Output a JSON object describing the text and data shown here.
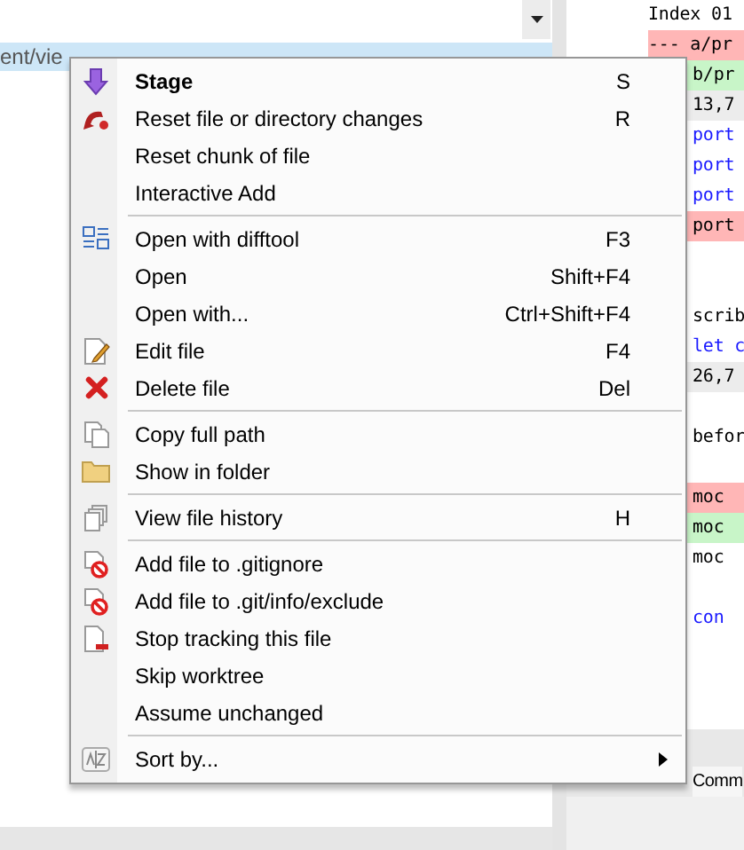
{
  "file_list": {
    "selected_row": {
      "text": "ent/vie",
      "selected": true
    }
  },
  "context_menu": {
    "sections": [
      [
        {
          "label": "Stage",
          "shortcut": "S",
          "default": true,
          "submenu": false
        },
        {
          "label": "Reset file or directory changes",
          "shortcut": "R",
          "default": false,
          "submenu": false
        },
        {
          "label": "Reset chunk of file",
          "default": false,
          "submenu": false
        },
        {
          "label": "Interactive Add",
          "default": false,
          "submenu": false
        }
      ],
      [
        {
          "label": "Open with difftool",
          "shortcut": "F3",
          "default": false,
          "submenu": false
        },
        {
          "label": "Open",
          "shortcut": "Shift+F4",
          "default": false,
          "submenu": false
        },
        {
          "label": "Open with...",
          "shortcut": "Ctrl+Shift+F4",
          "default": false,
          "submenu": false
        },
        {
          "label": "Edit file",
          "shortcut": "F4",
          "default": false,
          "submenu": false
        },
        {
          "label": "Delete file",
          "shortcut": "Del",
          "default": false,
          "submenu": false
        }
      ],
      [
        {
          "label": "Copy full path",
          "default": false,
          "submenu": false
        },
        {
          "label": "Show in folder",
          "default": false,
          "submenu": false
        }
      ],
      [
        {
          "label": "View file history",
          "shortcut": "H",
          "default": false,
          "submenu": false
        }
      ],
      [
        {
          "label": "Add file to .gitignore",
          "default": false,
          "submenu": false
        },
        {
          "label": "Add file to .git/info/exclude",
          "default": false,
          "submenu": false
        },
        {
          "label": "Stop tracking this file",
          "default": false,
          "submenu": false
        },
        {
          "label": "Skip worktree",
          "default": false,
          "submenu": false
        },
        {
          "label": "Assume unchanged",
          "default": false,
          "submenu": false
        }
      ],
      [
        {
          "label": "Sort by...",
          "default": false,
          "submenu": true
        }
      ]
    ]
  },
  "diff": {
    "header_lines": [
      {
        "text": "Index 01",
        "kind": "meta"
      },
      {
        "text": "--- a/pr",
        "kind": "removed"
      }
    ],
    "lines": [
      {
        "text": "b/pr",
        "kind": "added"
      },
      {
        "text": "13,7",
        "kind": "hunk"
      },
      {
        "text": "port",
        "kind": "keyword"
      },
      {
        "text": "port",
        "kind": "keyword"
      },
      {
        "text": "port",
        "kind": "keyword"
      },
      {
        "text": "port",
        "kind": "removed"
      },
      {
        "kind": "blank"
      },
      {
        "kind": "blank"
      },
      {
        "text": "scrib",
        "kind": "context"
      },
      {
        "text": "let c",
        "kind": "keyword"
      },
      {
        "text": "26,7",
        "kind": "hunk"
      },
      {
        "kind": "blank"
      },
      {
        "text": "befor",
        "kind": "context"
      },
      {
        "kind": "blank"
      },
      {
        "text": "moc",
        "kind": "removed"
      },
      {
        "text": "moc",
        "kind": "added"
      },
      {
        "text": "moc",
        "kind": "context"
      },
      {
        "kind": "blank"
      },
      {
        "text": "con",
        "kind": "keyword"
      }
    ]
  },
  "commit_tab": {
    "label": "Comm"
  }
}
